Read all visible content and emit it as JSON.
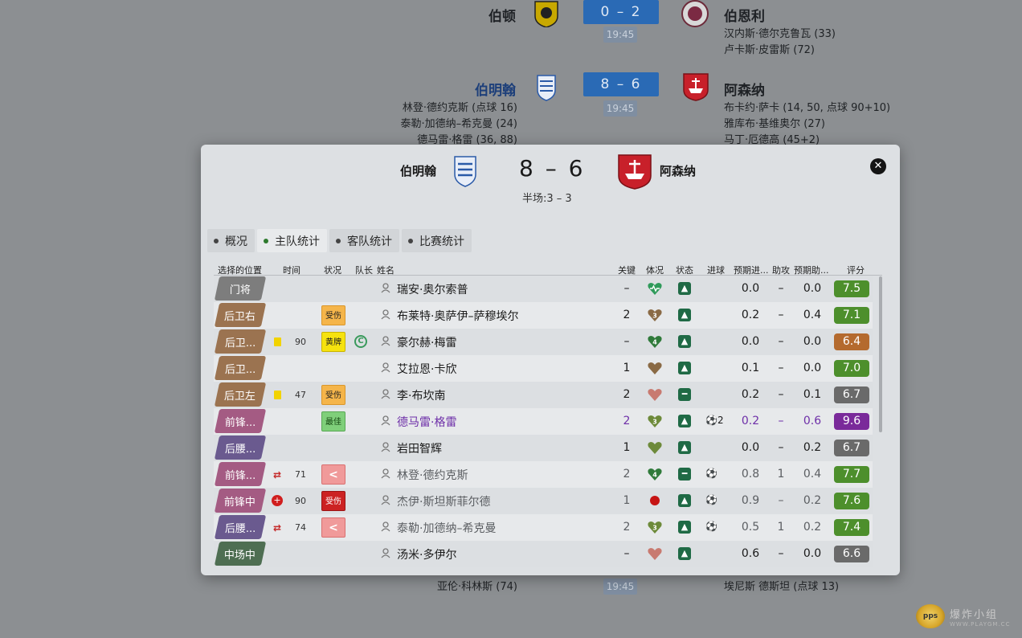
{
  "background": {
    "fixtures": [
      {
        "home": "伯顿",
        "away": "伯恩利",
        "score": "0 – 2",
        "time": "19:45",
        "home_scorers": [],
        "away_scorers": [
          "汉内斯·德尔克鲁瓦 (33)",
          "卢卡斯·皮雷斯 (72)"
        ]
      },
      {
        "home": "伯明翰",
        "away": "阿森纳",
        "score": "8 – 6",
        "time": "19:45",
        "home_scorers": [
          "林登·德约克斯 (点球 16)",
          "泰勒·加德纳–希克曼 (24)",
          "德马雷·格雷 (36, 88)"
        ],
        "away_scorers": [
          "布卡约·萨卡 (14, 50, 点球 90+10)",
          "雅库布·基维奥尔 (27)",
          "马丁·厄德高 (45+2)"
        ]
      },
      {
        "time": "19:45",
        "home_scorers": [
          "亚伦·科林斯 (74)"
        ],
        "away_scorers": [
          "埃尼斯 德斯坦 (点球 13)"
        ]
      }
    ]
  },
  "modal": {
    "home_team": "伯明翰",
    "away_team": "阿森纳",
    "score": "8 – 6",
    "half_time": "半场:3 – 3",
    "close_symbol": "✕",
    "tabs": [
      {
        "label": "概况",
        "active": false
      },
      {
        "label": "主队统计",
        "active": true
      },
      {
        "label": "客队统计",
        "active": false
      },
      {
        "label": "比赛统计",
        "active": false
      }
    ],
    "columns": {
      "position": "选择的位置",
      "time": "时间",
      "status": "状况",
      "captain": "队长",
      "name": "姓名",
      "key": "关键",
      "condition": "体况",
      "form": "状态",
      "goals": "进球",
      "xg": "预期进...",
      "assists": "助攻",
      "xa": "预期助...",
      "rating": "评分"
    },
    "players": [
      {
        "position": "门将",
        "pos_color": "#7d7d7d",
        "minutes": "",
        "event": "",
        "badge": "",
        "badge_type": "",
        "captain": false,
        "name": "瑞安·奥尔索普",
        "key": "–",
        "condition": "heart-full",
        "cond_num": "",
        "form": "up",
        "goals": "",
        "xg": "0.0",
        "assists": "–",
        "xa": "0.0",
        "rating": "7.5",
        "rating_color": "#4d8f2c",
        "style": ""
      },
      {
        "position": "后卫右",
        "pos_color": "#9b7350",
        "minutes": "",
        "event": "",
        "badge": "受伤",
        "badge_type": "injured",
        "captain": false,
        "name": "布莱特·奥萨伊–萨穆埃尔",
        "key": "2",
        "condition": "heart-brown",
        "cond_num": "3",
        "form": "up",
        "goals": "",
        "xg": "0.2",
        "assists": "–",
        "xa": "0.4",
        "rating": "7.1",
        "rating_color": "#4d8f2c",
        "style": ""
      },
      {
        "position": "后卫...",
        "pos_color": "#9b7350",
        "minutes": "90",
        "event": "yellow",
        "badge": "黄牌",
        "badge_type": "yellow",
        "captain": true,
        "name": "豪尔赫·梅雷",
        "key": "–",
        "condition": "heart-green",
        "cond_num": "4",
        "form": "up",
        "goals": "",
        "xg": "0.0",
        "assists": "–",
        "xa": "0.0",
        "rating": "6.4",
        "rating_color": "#b46a2e",
        "style": ""
      },
      {
        "position": "后卫...",
        "pos_color": "#9b7350",
        "minutes": "",
        "event": "",
        "badge": "",
        "badge_type": "",
        "captain": false,
        "name": "艾拉恩·卡欣",
        "key": "1",
        "condition": "heart-brown",
        "cond_num": "",
        "form": "up",
        "goals": "",
        "xg": "0.1",
        "assists": "–",
        "xa": "0.0",
        "rating": "7.0",
        "rating_color": "#4d8f2c",
        "style": ""
      },
      {
        "position": "后卫左",
        "pos_color": "#9b7350",
        "minutes": "47",
        "event": "yellow",
        "badge": "受伤",
        "badge_type": "injured",
        "captain": false,
        "name": "李·布坎南",
        "key": "2",
        "condition": "heart-red",
        "cond_num": "",
        "form": "flat",
        "goals": "",
        "xg": "0.2",
        "assists": "–",
        "xa": "0.1",
        "rating": "6.7",
        "rating_color": "#6a6a6a",
        "style": ""
      },
      {
        "position": "前锋...",
        "pos_color": "#a45b83",
        "minutes": "",
        "event": "",
        "badge": "最佳",
        "badge_type": "best",
        "captain": false,
        "name": "德马雷·格雷",
        "key": "2",
        "condition": "heart-olive",
        "cond_num": "3",
        "form": "up",
        "goals": "2",
        "xg": "0.2",
        "assists": "–",
        "xa": "0.6",
        "rating": "9.6",
        "rating_color": "#7a2a9a",
        "style": "purple"
      },
      {
        "position": "后腰...",
        "pos_color": "#6a5a8f",
        "minutes": "",
        "event": "",
        "badge": "",
        "badge_type": "",
        "captain": false,
        "name": "岩田智辉",
        "key": "1",
        "condition": "heart-olive",
        "cond_num": "",
        "form": "up",
        "goals": "",
        "xg": "0.0",
        "assists": "–",
        "xa": "0.2",
        "rating": "6.7",
        "rating_color": "#6a6a6a",
        "style": ""
      },
      {
        "position": "前锋...",
        "pos_color": "#a45b83",
        "minutes": "71",
        "event": "sub",
        "badge": "<",
        "badge_type": "sub-out",
        "captain": false,
        "name": "林登·德约克斯",
        "key": "2",
        "condition": "heart-green",
        "cond_num": "4",
        "form": "flat",
        "goals": "1",
        "xg": "0.8",
        "assists": "1",
        "xa": "0.4",
        "rating": "7.7",
        "rating_color": "#4d8f2c",
        "style": "dim"
      },
      {
        "position": "前锋中",
        "pos_color": "#a45b83",
        "minutes": "90",
        "event": "injury",
        "badge": "受伤",
        "badge_type": "inj-red",
        "captain": false,
        "name": "杰伊·斯坦斯菲尔德",
        "key": "1",
        "condition": "red-dot",
        "cond_num": "",
        "form": "up",
        "goals": "1",
        "xg": "0.9",
        "assists": "–",
        "xa": "0.2",
        "rating": "7.6",
        "rating_color": "#4d8f2c",
        "style": "dim"
      },
      {
        "position": "后腰...",
        "pos_color": "#6a5a8f",
        "minutes": "74",
        "event": "sub",
        "badge": "<",
        "badge_type": "sub-out",
        "captain": false,
        "name": "泰勒·加德纳–希克曼",
        "key": "2",
        "condition": "heart-olive",
        "cond_num": "3",
        "form": "up",
        "goals": "1",
        "xg": "0.5",
        "assists": "1",
        "xa": "0.2",
        "rating": "7.4",
        "rating_color": "#4d8f2c",
        "style": "dim"
      },
      {
        "position": "中场中",
        "pos_color": "#4e6e52",
        "minutes": "",
        "event": "",
        "badge": "",
        "badge_type": "",
        "captain": false,
        "name": "汤米·多伊尔",
        "key": "–",
        "condition": "heart-red",
        "cond_num": "",
        "form": "up",
        "goals": "",
        "xg": "0.6",
        "assists": "–",
        "xa": "0.0",
        "rating": "6.6",
        "rating_color": "#6a6a6a",
        "style": ""
      }
    ]
  },
  "watermark": {
    "logo_text": "pps",
    "text": "爆炸小组",
    "url": "WWW.PLAYGM.CC"
  }
}
